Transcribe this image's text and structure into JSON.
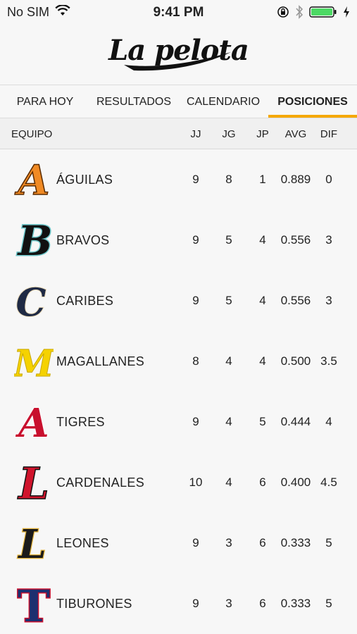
{
  "status": {
    "carrier": "No SIM",
    "time": "9:41 PM"
  },
  "app": {
    "logo_text": "La pelota"
  },
  "tabs": [
    {
      "label": "PARA HOY"
    },
    {
      "label": "RESULTADOS"
    },
    {
      "label": "CALENDARIO"
    },
    {
      "label": "POSICIONES"
    }
  ],
  "active_tab": "POSICIONES",
  "table": {
    "headers": {
      "team": "EQUIPO",
      "jj": "JJ",
      "jg": "JG",
      "jp": "JP",
      "avg": "AVG",
      "dif": "DIF"
    },
    "rows": [
      {
        "team": "ÁGUILAS",
        "jj": "9",
        "jg": "8",
        "jp": "1",
        "avg": "0.889",
        "dif": "0",
        "logo_letter": "A",
        "logo_color": "#f08a24"
      },
      {
        "team": "BRAVOS",
        "jj": "9",
        "jg": "5",
        "jp": "4",
        "avg": "0.556",
        "dif": "3",
        "logo_letter": "B",
        "logo_color": "#111111"
      },
      {
        "team": "CARIBES",
        "jj": "9",
        "jg": "5",
        "jp": "4",
        "avg": "0.556",
        "dif": "3",
        "logo_letter": "C",
        "logo_color": "#1f2a44"
      },
      {
        "team": "MAGALLANES",
        "jj": "8",
        "jg": "4",
        "jp": "4",
        "avg": "0.500",
        "dif": "3.5",
        "logo_letter": "M",
        "logo_color": "#f5d200"
      },
      {
        "team": "TIGRES",
        "jj": "9",
        "jg": "4",
        "jp": "5",
        "avg": "0.444",
        "dif": "4",
        "logo_letter": "A",
        "logo_color": "#c8102e"
      },
      {
        "team": "CARDENALES",
        "jj": "10",
        "jg": "4",
        "jp": "6",
        "avg": "0.400",
        "dif": "4.5",
        "logo_letter": "L",
        "logo_color": "#d0142c"
      },
      {
        "team": "LEONES",
        "jj": "9",
        "jg": "3",
        "jp": "6",
        "avg": "0.333",
        "dif": "5",
        "logo_letter": "L",
        "logo_color": "#1a1a1a"
      },
      {
        "team": "TIBURONES",
        "jj": "9",
        "jg": "3",
        "jp": "6",
        "avg": "0.333",
        "dif": "5",
        "logo_letter": "T",
        "logo_color": "#1d2f6f"
      }
    ]
  },
  "colors": {
    "accent": "#f5a800",
    "battery": "#4cd964"
  }
}
